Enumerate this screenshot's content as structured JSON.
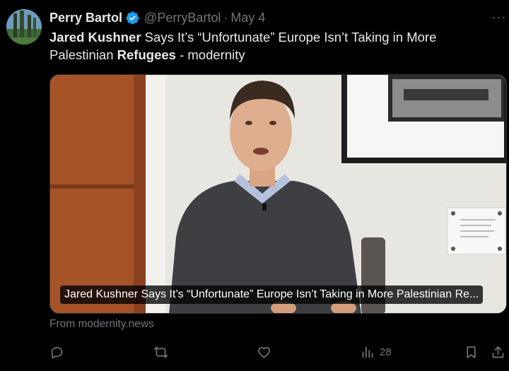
{
  "tweet": {
    "author_name": "Perry Bartol",
    "handle": "@PerryBartol",
    "separator": "·",
    "date": "May 4",
    "more_label": "···",
    "text_parts": [
      {
        "text": "Jared Kushner",
        "bold": true
      },
      {
        "text": " Says It’s “Unfortunate” Europe Isn’t Taking in More Palestinian ",
        "bold": false
      },
      {
        "text": "Refugees",
        "bold": true
      },
      {
        "text": " - modernity",
        "bold": false
      }
    ]
  },
  "card": {
    "caption": "Jared Kushner Says It’s “Unfortunate” Europe Isn’t Taking in More Palestinian Re...",
    "source": "From modernity.news"
  },
  "actions": {
    "reply_icon": "reply-icon",
    "retweet_icon": "retweet-icon",
    "like_icon": "heart-icon",
    "views_icon": "views-icon",
    "views_count": "28",
    "bookmark_icon": "bookmark-icon",
    "share_icon": "share-icon"
  },
  "colors": {
    "background": "#000000",
    "text_primary": "#e7e9ea",
    "text_secondary": "#71767b",
    "verified_badge": "#1d9bf0"
  }
}
